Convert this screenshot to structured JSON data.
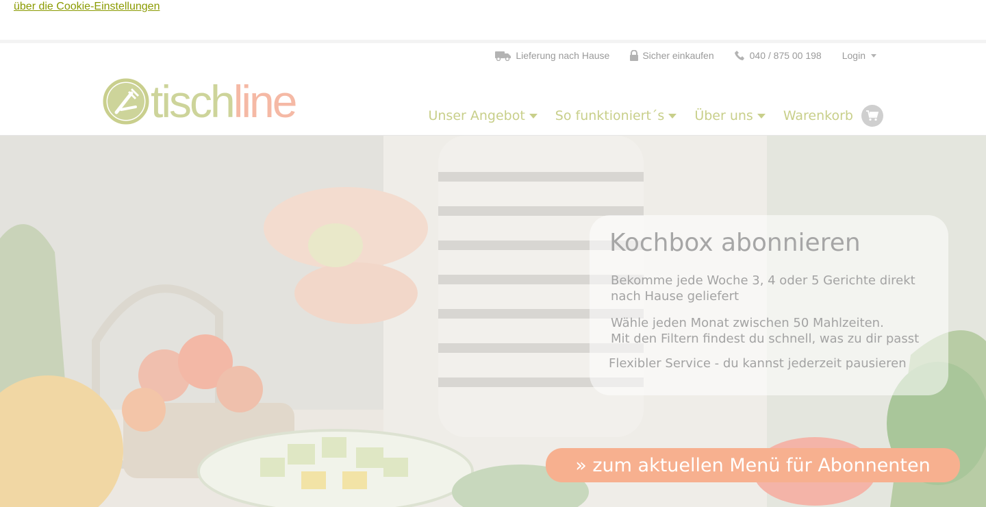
{
  "cookie": {
    "link_text": "über die Cookie-Einstellungen"
  },
  "topbar": {
    "delivery": "Lieferung nach Hause",
    "secure": "Sicher einkaufen",
    "phone": "040 / 875 00 198",
    "login": "Login"
  },
  "logo": {
    "part1": "tisch",
    "part2": "line"
  },
  "nav": {
    "offer": "Unser Angebot",
    "how": "So funktioniert´s",
    "about": "Über uns",
    "cart": "Warenkorb"
  },
  "hero": {
    "title": "Kochbox abonnieren",
    "line1": "Bekomme jede Woche 3, 4 oder 5 Gerichte direkt nach Hause geliefert",
    "line2a": "Wähle jeden Monat zwischen 50 Mahlzeiten.",
    "line2b": "Mit den Filtern findest du schnell, was zu dir passt",
    "line3": "Flexibler Service - du kannst jederzeit pausieren",
    "cta": "» zum aktuellen Menü für Abonnenten"
  },
  "colors": {
    "brand_green": "#c8cf8a",
    "brand_salmon": "#f5b9a5",
    "cta": "#f7b08f",
    "cookie_link": "#8a9a00"
  }
}
